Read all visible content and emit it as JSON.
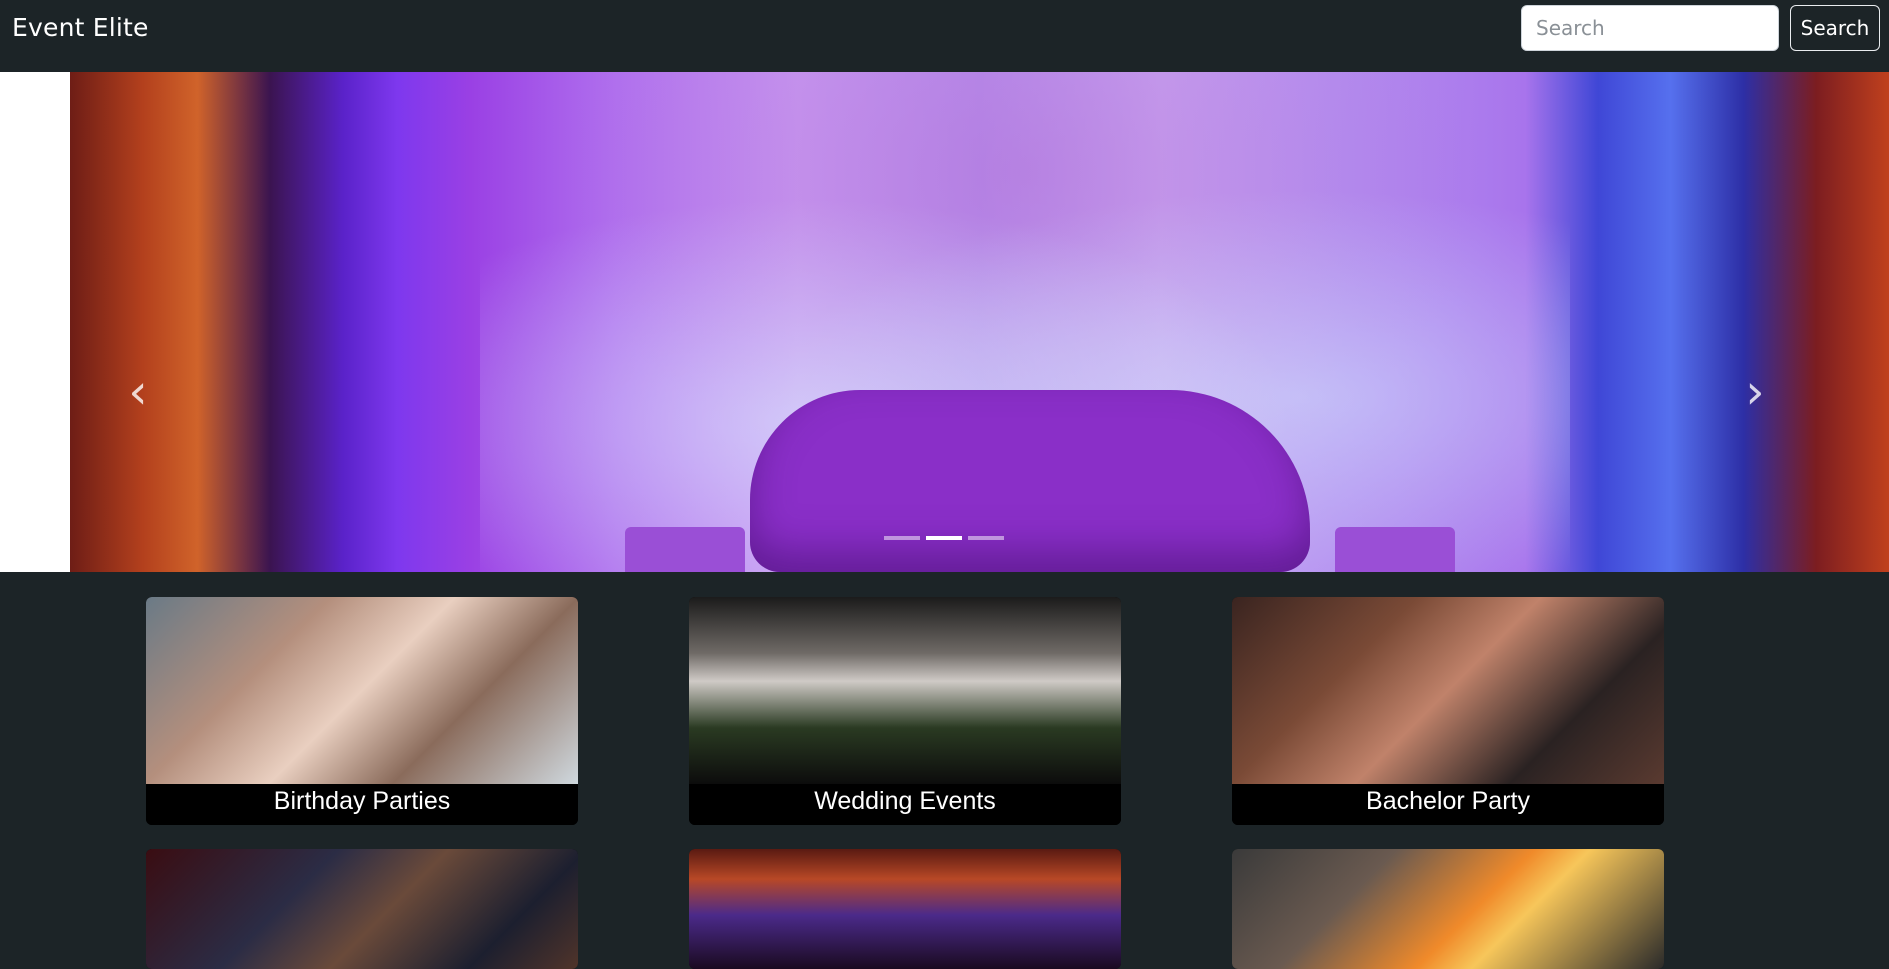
{
  "navbar": {
    "brand": "Event Elite",
    "search_placeholder": "Search",
    "search_value": "",
    "search_button": "Search"
  },
  "carousel": {
    "prev_icon": "chevron-left-icon",
    "next_icon": "chevron-right-icon",
    "prev_glyph": "‹",
    "next_glyph": "›",
    "indicator_count": 3,
    "active_indicator": 2
  },
  "cards": [
    {
      "caption": "Birthday Parties"
    },
    {
      "caption": "Wedding Events"
    },
    {
      "caption": "Bachelor Party"
    },
    {
      "caption": ""
    },
    {
      "caption": ""
    },
    {
      "caption": ""
    }
  ],
  "colors": {
    "navbar_bg": "#1c2427",
    "page_bg": "#1c2427",
    "caption_bg": "#000000",
    "text": "#ffffff"
  }
}
